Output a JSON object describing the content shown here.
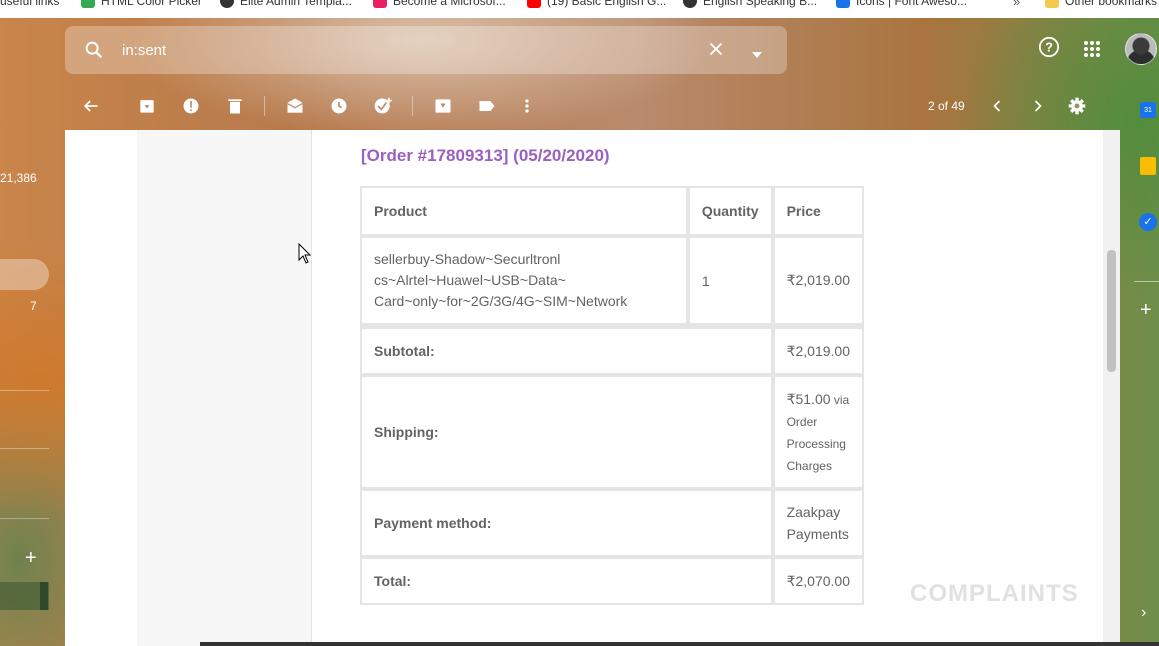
{
  "bookmarks": [
    {
      "label": "useful links",
      "color": "#f2c94c"
    },
    {
      "label": "HTML Color Picker",
      "color": "#34a853"
    },
    {
      "label": "Elite Admin Templa...",
      "color": "#333333"
    },
    {
      "label": "Become a Microsof...",
      "color": "#e91e63"
    },
    {
      "label": "(19) Basic English G...",
      "color": "#ff0000"
    },
    {
      "label": "English Speaking B...",
      "color": "#333333"
    },
    {
      "label": "Icons | Font Aweso...",
      "color": "#1a73e8"
    },
    {
      "label": "Other bookmarks",
      "color": "#f2c94c"
    }
  ],
  "bookmarks_more": "»",
  "search": {
    "value": "in:sent"
  },
  "toolbar": {
    "pager": "2 of 49"
  },
  "sidebar": {
    "count_all": "21,386",
    "count_item": "7"
  },
  "right_panel": {
    "calendar_day": "31"
  },
  "email": {
    "order_title": "[Order #17809313] (05/20/2020)",
    "headers": {
      "product": "Product",
      "quantity": "Quantity",
      "price": "Price"
    },
    "item": {
      "name_line1": "sellerbuy-Shadow~Securltronl",
      "name_line2": "cs~Alrtel~Huawel~USB~Data~",
      "name_line3": "Card~only~for~2G/3G/4G~SIM~Network",
      "quantity": "1",
      "price": "₹2,019.00"
    },
    "subtotal": {
      "label": "Subtotal:",
      "value": "₹2,019.00"
    },
    "shipping": {
      "label": "Shipping:",
      "value": "₹51.00",
      "via_line1": "via",
      "via_line2": "Order",
      "via_line3": "Processing",
      "via_line4": "Charges"
    },
    "payment": {
      "label": "Payment method:",
      "value_line1": "Zaakpay",
      "value_line2": "Payments"
    },
    "total": {
      "label": "Total:",
      "value": "₹2,070.00"
    }
  },
  "watermark": "COMPLAINTS"
}
